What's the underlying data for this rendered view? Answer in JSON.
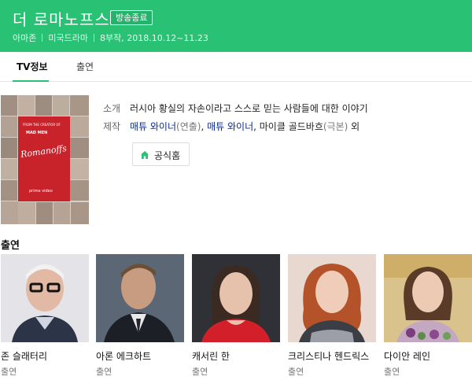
{
  "header": {
    "title": "더 로마노프스",
    "badge": "방송종료",
    "meta": [
      "아마존",
      "미국드라마",
      "8부작, 2018.10.12~11.23"
    ]
  },
  "tabs": [
    {
      "label": "TV정보",
      "active": true
    },
    {
      "label": "출연",
      "active": false
    }
  ],
  "info": {
    "summary_label": "소개",
    "summary_text": "러시아 황실의 자손이라고 스스로 믿는 사람들에 대한 이야기",
    "production_label": "제작",
    "production": {
      "p1_name": "매튜 와이너",
      "p1_role": "(연출)",
      "sep": ",",
      "p2_name": "매튜 와이너",
      "p2_tail": ", 마이클 골드바흐",
      "p2_role": "(극본)",
      "etc": "외"
    },
    "homepage_label": "공식홈"
  },
  "poster": {
    "small_text": "FROM THE CREATOR OF",
    "show_text": "MAD MEN",
    "script_title": "Romanoffs",
    "brand": "prime video"
  },
  "cast_heading": "출연",
  "cast": [
    {
      "name": "존 슬래터리",
      "role": "출연"
    },
    {
      "name": "아론 에크하트",
      "role": "출연"
    },
    {
      "name": "캐서린 한",
      "role": "출연"
    },
    {
      "name": "크리스티나 헨드릭스",
      "role": "출연"
    },
    {
      "name": "다이안 레인",
      "role": "출연"
    }
  ],
  "colors": {
    "accent": "#29c274",
    "link": "#0a2c8c"
  }
}
